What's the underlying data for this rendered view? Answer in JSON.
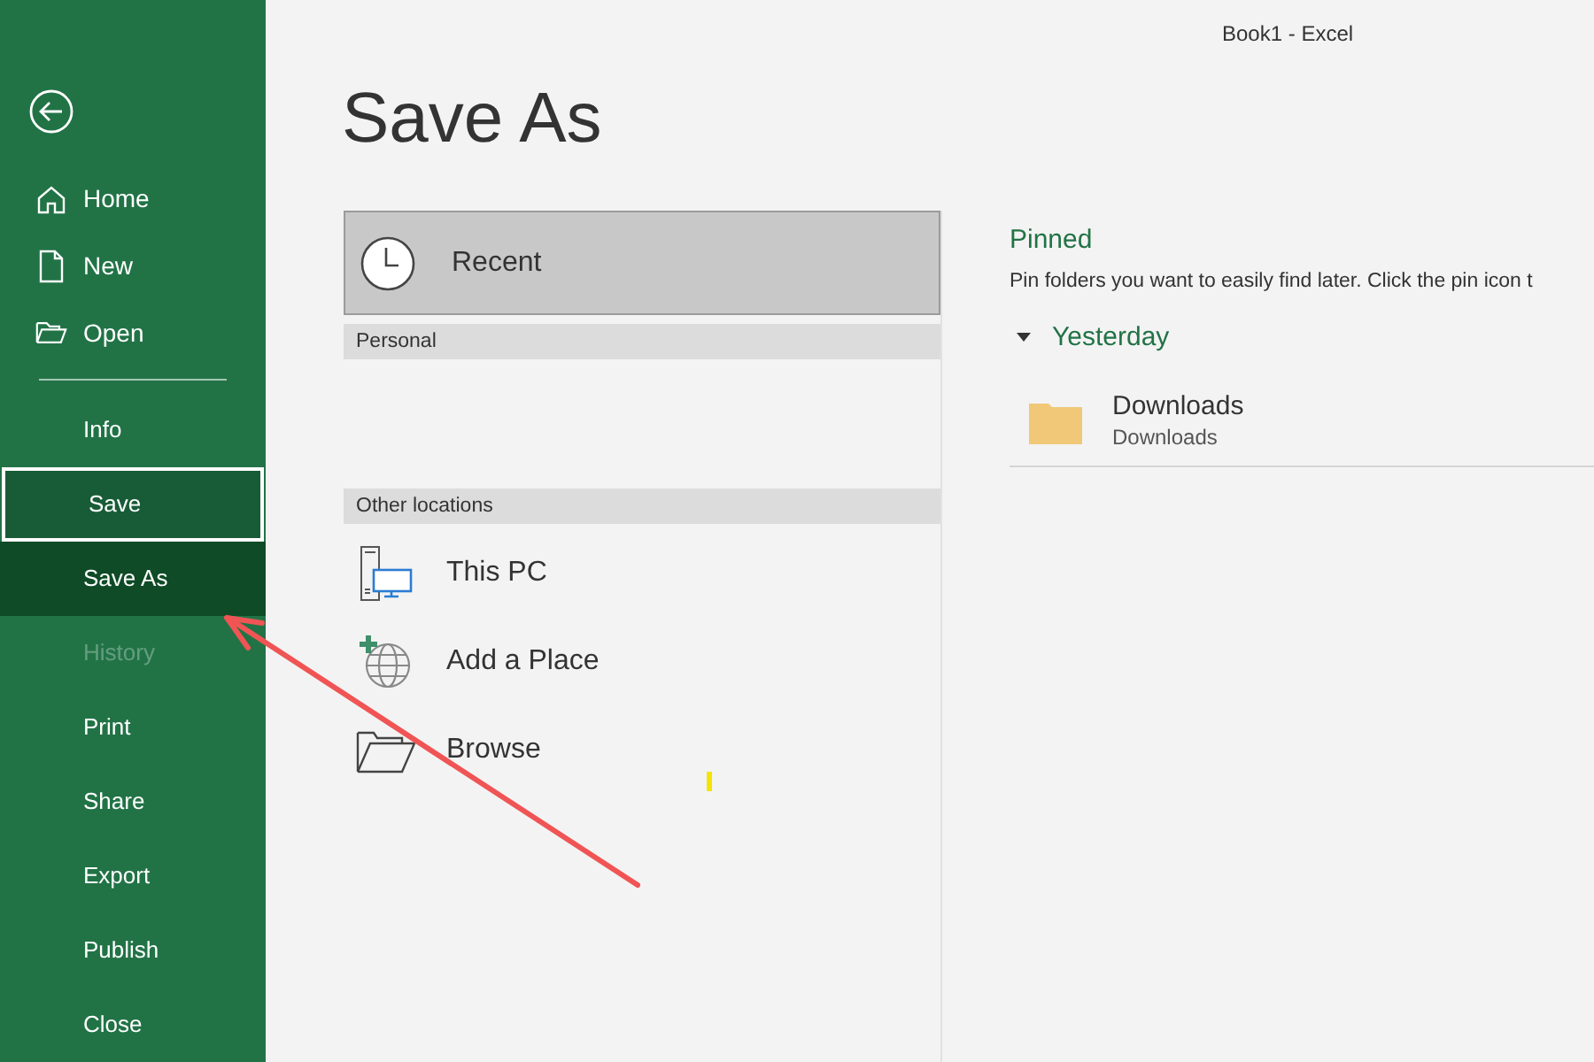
{
  "window": {
    "title": "Book1 - Excel"
  },
  "sidebar": {
    "top_items": [
      {
        "label": "Home"
      },
      {
        "label": "New"
      },
      {
        "label": "Open"
      }
    ],
    "items": [
      {
        "label": "Info",
        "selected": false,
        "focused": false,
        "disabled": false
      },
      {
        "label": "Save",
        "selected": false,
        "focused": true,
        "disabled": false
      },
      {
        "label": "Save As",
        "selected": true,
        "focused": false,
        "disabled": false
      },
      {
        "label": "History",
        "selected": false,
        "focused": false,
        "disabled": true
      },
      {
        "label": "Print",
        "selected": false,
        "focused": false,
        "disabled": false
      },
      {
        "label": "Share",
        "selected": false,
        "focused": false,
        "disabled": false
      },
      {
        "label": "Export",
        "selected": false,
        "focused": false,
        "disabled": false
      },
      {
        "label": "Publish",
        "selected": false,
        "focused": false,
        "disabled": false
      },
      {
        "label": "Close",
        "selected": false,
        "focused": false,
        "disabled": false
      }
    ]
  },
  "page_title": "Save As",
  "recent": {
    "label": "Recent",
    "selected": true
  },
  "sections": [
    {
      "heading": "Personal"
    },
    {
      "heading": "Other locations",
      "items": [
        {
          "kind": "pc",
          "label": "This PC"
        },
        {
          "kind": "place",
          "label": "Add a Place"
        },
        {
          "kind": "browse",
          "label": "Browse"
        }
      ]
    }
  ],
  "pinned": {
    "heading": "Pinned",
    "hint": "Pin folders you want to easily find later. Click the pin icon t"
  },
  "groups": [
    {
      "label": "Yesterday",
      "expanded": true,
      "folders": [
        {
          "name": "Downloads",
          "path": "Downloads"
        }
      ]
    }
  ]
}
